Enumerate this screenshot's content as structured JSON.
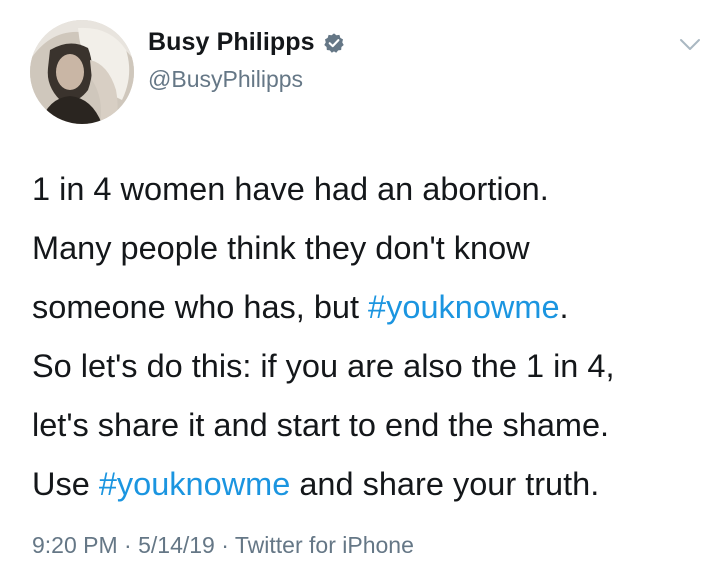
{
  "author": {
    "display_name": "Busy Philipps",
    "handle": "@BusyPhilipps",
    "verified": true
  },
  "tweet": {
    "lines": [
      {
        "before": "1 in 4 women have had an abortion.",
        "hashtag": "",
        "after": ""
      },
      {
        "before": "Many people think they don't know",
        "hashtag": "",
        "after": ""
      },
      {
        "before": "someone who has, but ",
        "hashtag": "#youknowme",
        "after": "."
      },
      {
        "before": "So let's do this: if you are also the 1 in 4,",
        "hashtag": "",
        "after": ""
      },
      {
        "before": "let's share it and start to end the shame.",
        "hashtag": "",
        "after": ""
      },
      {
        "before": "Use ",
        "hashtag": "#youknowme",
        "after": " and share your truth."
      }
    ]
  },
  "meta": {
    "time": "9:20 PM",
    "sep1": " · ",
    "date": "5/14/19",
    "sep2": " · ",
    "source": "Twitter for iPhone"
  },
  "icons": {
    "verified": "verified-badge-icon",
    "menu": "chevron-down-icon"
  },
  "colors": {
    "hashtag": "#1b95e0",
    "secondary_text": "#657786",
    "primary_text": "#14171a",
    "verified_badge": "#657786"
  }
}
